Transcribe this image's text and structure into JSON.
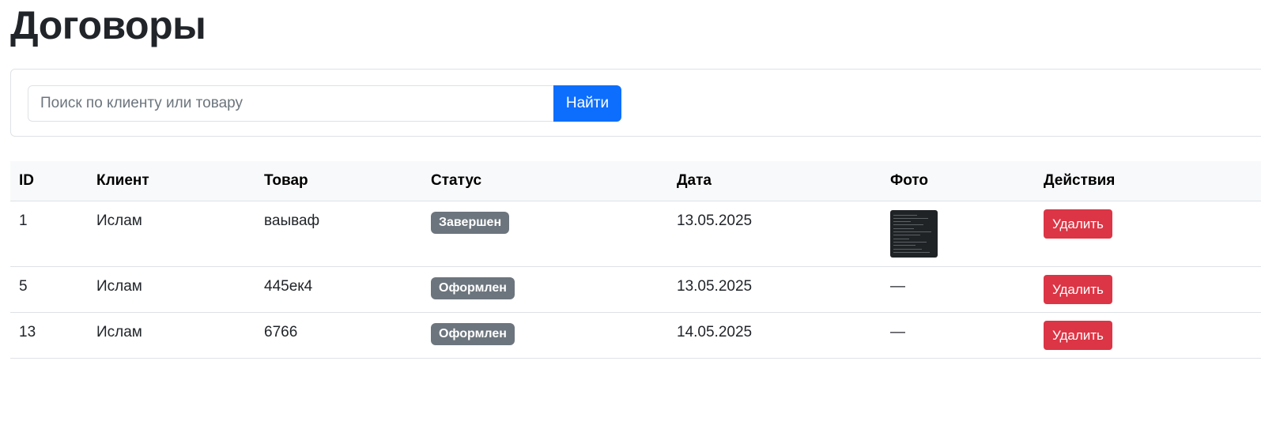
{
  "page": {
    "title": "Договоры"
  },
  "search": {
    "placeholder": "Поиск по клиенту или товару",
    "value": "",
    "button_label": "Найти"
  },
  "table": {
    "headers": [
      "ID",
      "Клиент",
      "Товар",
      "Статус",
      "Дата",
      "Фото",
      "Действия"
    ],
    "rows": [
      {
        "id": "1",
        "client": "Ислам",
        "product": "ваываф",
        "status": "Завершен",
        "date": "13.05.2025",
        "photo": "thumbnail",
        "action": "Удалить"
      },
      {
        "id": "5",
        "client": "Ислам",
        "product": "445ек4",
        "status": "Оформлен",
        "date": "13.05.2025",
        "photo": "—",
        "action": "Удалить"
      },
      {
        "id": "13",
        "client": "Ислам",
        "product": "6766",
        "status": "Оформлен",
        "date": "14.05.2025",
        "photo": "—",
        "action": "Удалить"
      }
    ]
  },
  "colors": {
    "primary": "#0d6efd",
    "danger": "#dc3545",
    "secondary": "#6c757d",
    "header_bg": "#f8f9fa"
  }
}
